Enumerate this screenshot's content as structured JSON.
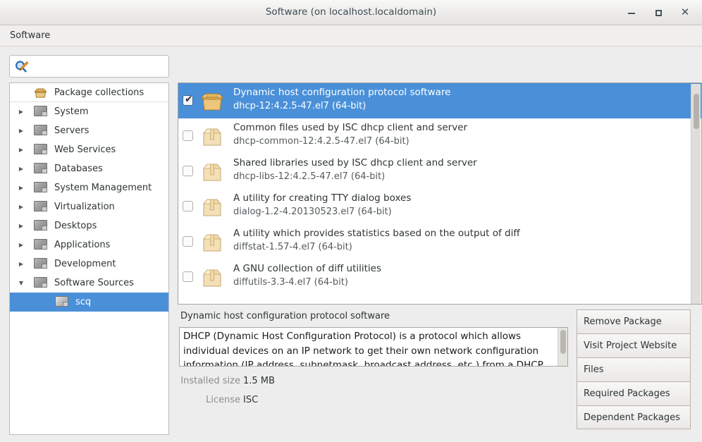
{
  "window": {
    "title": "Software (on localhost.localdomain)",
    "minimize_label": "–",
    "maximize_label": "",
    "close_label": "✕"
  },
  "menubar": {
    "items": [
      {
        "label": "Software"
      }
    ]
  },
  "search": {
    "icon": "search-edit-icon",
    "value": "",
    "placeholder": ""
  },
  "sidebar": {
    "items": [
      {
        "label": "Package collections",
        "icon": "open-box-icon",
        "expander": "",
        "indent": 0,
        "selected": false
      },
      {
        "label": "System",
        "icon": "screen-icon",
        "expander": "▶",
        "indent": 0,
        "selected": false
      },
      {
        "label": "Servers",
        "icon": "screen-icon",
        "expander": "▶",
        "indent": 0,
        "selected": false
      },
      {
        "label": "Web Services",
        "icon": "screen-icon",
        "expander": "▶",
        "indent": 0,
        "selected": false
      },
      {
        "label": "Databases",
        "icon": "screen-icon",
        "expander": "▶",
        "indent": 0,
        "selected": false
      },
      {
        "label": "System Management",
        "icon": "screen-icon",
        "expander": "▶",
        "indent": 0,
        "selected": false
      },
      {
        "label": "Virtualization",
        "icon": "screen-icon",
        "expander": "▶",
        "indent": 0,
        "selected": false
      },
      {
        "label": "Desktops",
        "icon": "screen-icon",
        "expander": "▶",
        "indent": 0,
        "selected": false
      },
      {
        "label": "Applications",
        "icon": "screen-icon",
        "expander": "▶",
        "indent": 0,
        "selected": false
      },
      {
        "label": "Development",
        "icon": "screen-icon",
        "expander": "▶",
        "indent": 0,
        "selected": false
      },
      {
        "label": "Software Sources",
        "icon": "screen-icon",
        "expander": "▼",
        "indent": 0,
        "selected": false
      },
      {
        "label": "scq",
        "icon": "screen-icon",
        "expander": "",
        "indent": 1,
        "selected": true
      }
    ]
  },
  "package_list": {
    "rows": [
      {
        "checked": true,
        "selected": true,
        "icon": "open-box-icon",
        "title": "Dynamic host configuration protocol software",
        "subtitle": "dhcp-12:4.2.5-47.el7 (64-bit)"
      },
      {
        "checked": false,
        "selected": false,
        "icon": "closed-box-icon",
        "title": "Common files used by ISC dhcp client and server",
        "subtitle": "dhcp-common-12:4.2.5-47.el7 (64-bit)"
      },
      {
        "checked": false,
        "selected": false,
        "icon": "closed-box-icon",
        "title": "Shared libraries used by ISC dhcp client and server",
        "subtitle": "dhcp-libs-12:4.2.5-47.el7 (64-bit)"
      },
      {
        "checked": false,
        "selected": false,
        "icon": "closed-box-icon",
        "title": "A utility for creating TTY dialog boxes",
        "subtitle": "dialog-1.2-4.20130523.el7 (64-bit)"
      },
      {
        "checked": false,
        "selected": false,
        "icon": "closed-box-icon",
        "title": "A utility which provides statistics based on the output of diff",
        "subtitle": "diffstat-1.57-4.el7 (64-bit)"
      },
      {
        "checked": false,
        "selected": false,
        "icon": "closed-box-icon",
        "title": "A GNU collection of diff utilities",
        "subtitle": "diffutils-3.3-4.el7 (64-bit)"
      }
    ]
  },
  "details": {
    "title": "Dynamic host configuration protocol software",
    "description": "DHCP (Dynamic Host Configuration Protocol) is a protocol which allows individual devices on an IP network to get their own network configuration information (IP address, subnetmask, broadcast address, etc.) from a DHCP server. The overall",
    "installed_size_label": "Installed size",
    "installed_size_value": "1.5 MB",
    "license_label": "License",
    "license_value": "ISC"
  },
  "actions": {
    "buttons": [
      {
        "label": "Remove Package"
      },
      {
        "label": "Visit Project Website"
      },
      {
        "label": "Files"
      },
      {
        "label": "Required Packages"
      },
      {
        "label": "Dependent Packages"
      }
    ]
  },
  "colors": {
    "selection_blue": "#4a90d9",
    "window_background": "#ededed",
    "panel_white": "#ffffff",
    "title_text": "#3f4c54"
  }
}
